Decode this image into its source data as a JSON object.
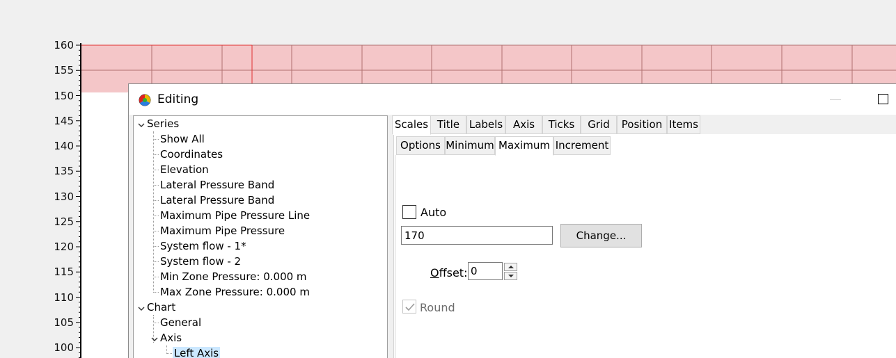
{
  "chart": {
    "yticks": [
      "160",
      "155",
      "150",
      "145",
      "140",
      "135",
      "130",
      "125",
      "120",
      "115",
      "110",
      "105",
      "100"
    ],
    "band_color": "#f4c6c8",
    "grid_color": "#b07070"
  },
  "dialog": {
    "title": "Editing",
    "app_icon": "color-wheel-icon",
    "minimize_icon": "minimize-icon",
    "maximize_icon": "maximize-icon"
  },
  "tree": {
    "series_label": "Series",
    "series_items": [
      "Show All",
      "Coordinates",
      "Elevation",
      "Lateral Pressure Band",
      "Lateral Pressure Band",
      "Maximum Pipe Pressure Line",
      "Maximum Pipe Pressure",
      "System flow - 1*",
      "System flow - 2",
      "Min Zone Pressure: 0.000 m",
      "Max Zone Pressure: 0.000 m"
    ],
    "chart_label": "Chart",
    "general_label": "General",
    "axis_label": "Axis",
    "left_axis_label": "Left Axis"
  },
  "tabs": {
    "main": [
      "Scales",
      "Title",
      "Labels",
      "Axis",
      "Ticks",
      "Grid",
      "Position",
      "Items"
    ],
    "main_active": "Scales",
    "sub": [
      "Options",
      "Minimum",
      "Maximum",
      "Increment"
    ],
    "sub_active": "Maximum"
  },
  "maximum": {
    "auto_label": "Auto",
    "auto_checked": false,
    "value": "170",
    "change_label": "Change...",
    "offset_label_prefix": "O",
    "offset_label_rest": "ffset:",
    "offset_value": "0",
    "round_label": "Round",
    "round_checked": true
  }
}
